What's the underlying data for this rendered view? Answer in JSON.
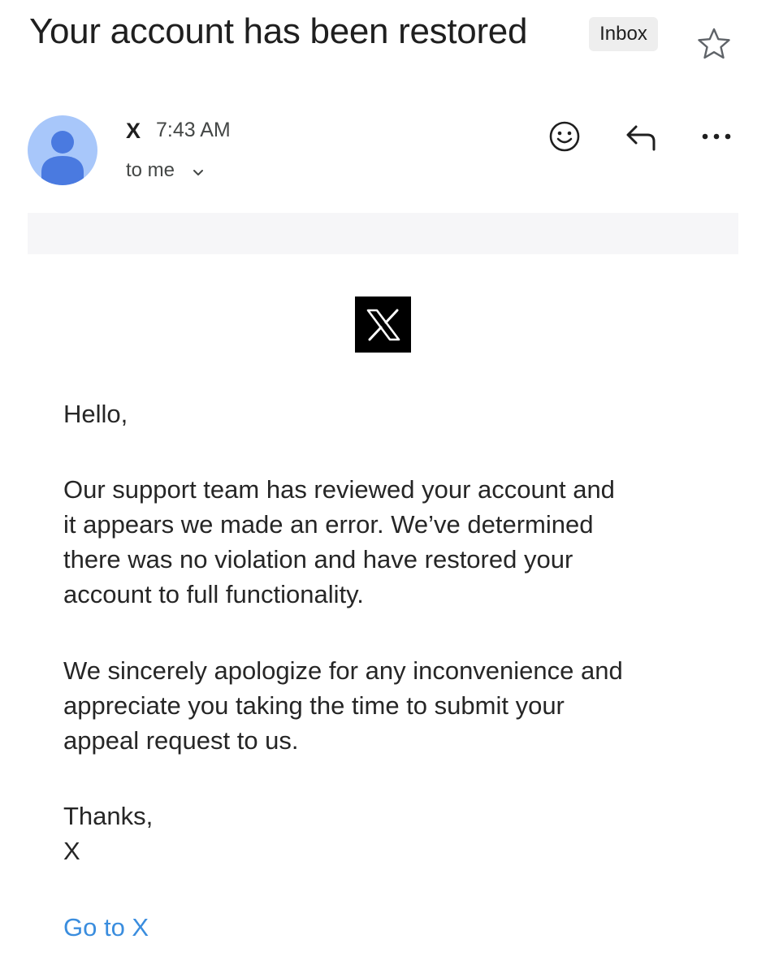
{
  "email": {
    "subject": "Your account has been restored",
    "label": "Inbox",
    "sender": {
      "name": "X",
      "time": "7:43 AM",
      "recipient": "to me"
    },
    "body": {
      "greeting": "Hello,",
      "paragraph1": [
        "Our support team has reviewed your account and",
        "it appears we made an error. We’ve determined",
        "there was no violation and have restored your",
        "account to full functionality."
      ],
      "paragraph2": [
        "We sincerely apologize for any inconvenience and",
        "appreciate you taking the time to submit your",
        "appeal request to us."
      ],
      "signoff": "Thanks,",
      "signature": "X",
      "cta_link": "Go to X"
    }
  },
  "icons": {
    "star": "star-icon",
    "avatar": "person-icon",
    "emoji": "emoji-reaction-icon",
    "reply": "reply-icon",
    "more": "more-options-icon",
    "chevron": "chevron-down-icon",
    "logo": "x-logo-icon"
  },
  "colors": {
    "avatar_bg": "#a8c7fa",
    "avatar_fg": "#4a7ae0",
    "link": "#3a8dde",
    "label_chip_bg": "#eeeeee",
    "banner_bg": "#f6f6f8"
  }
}
